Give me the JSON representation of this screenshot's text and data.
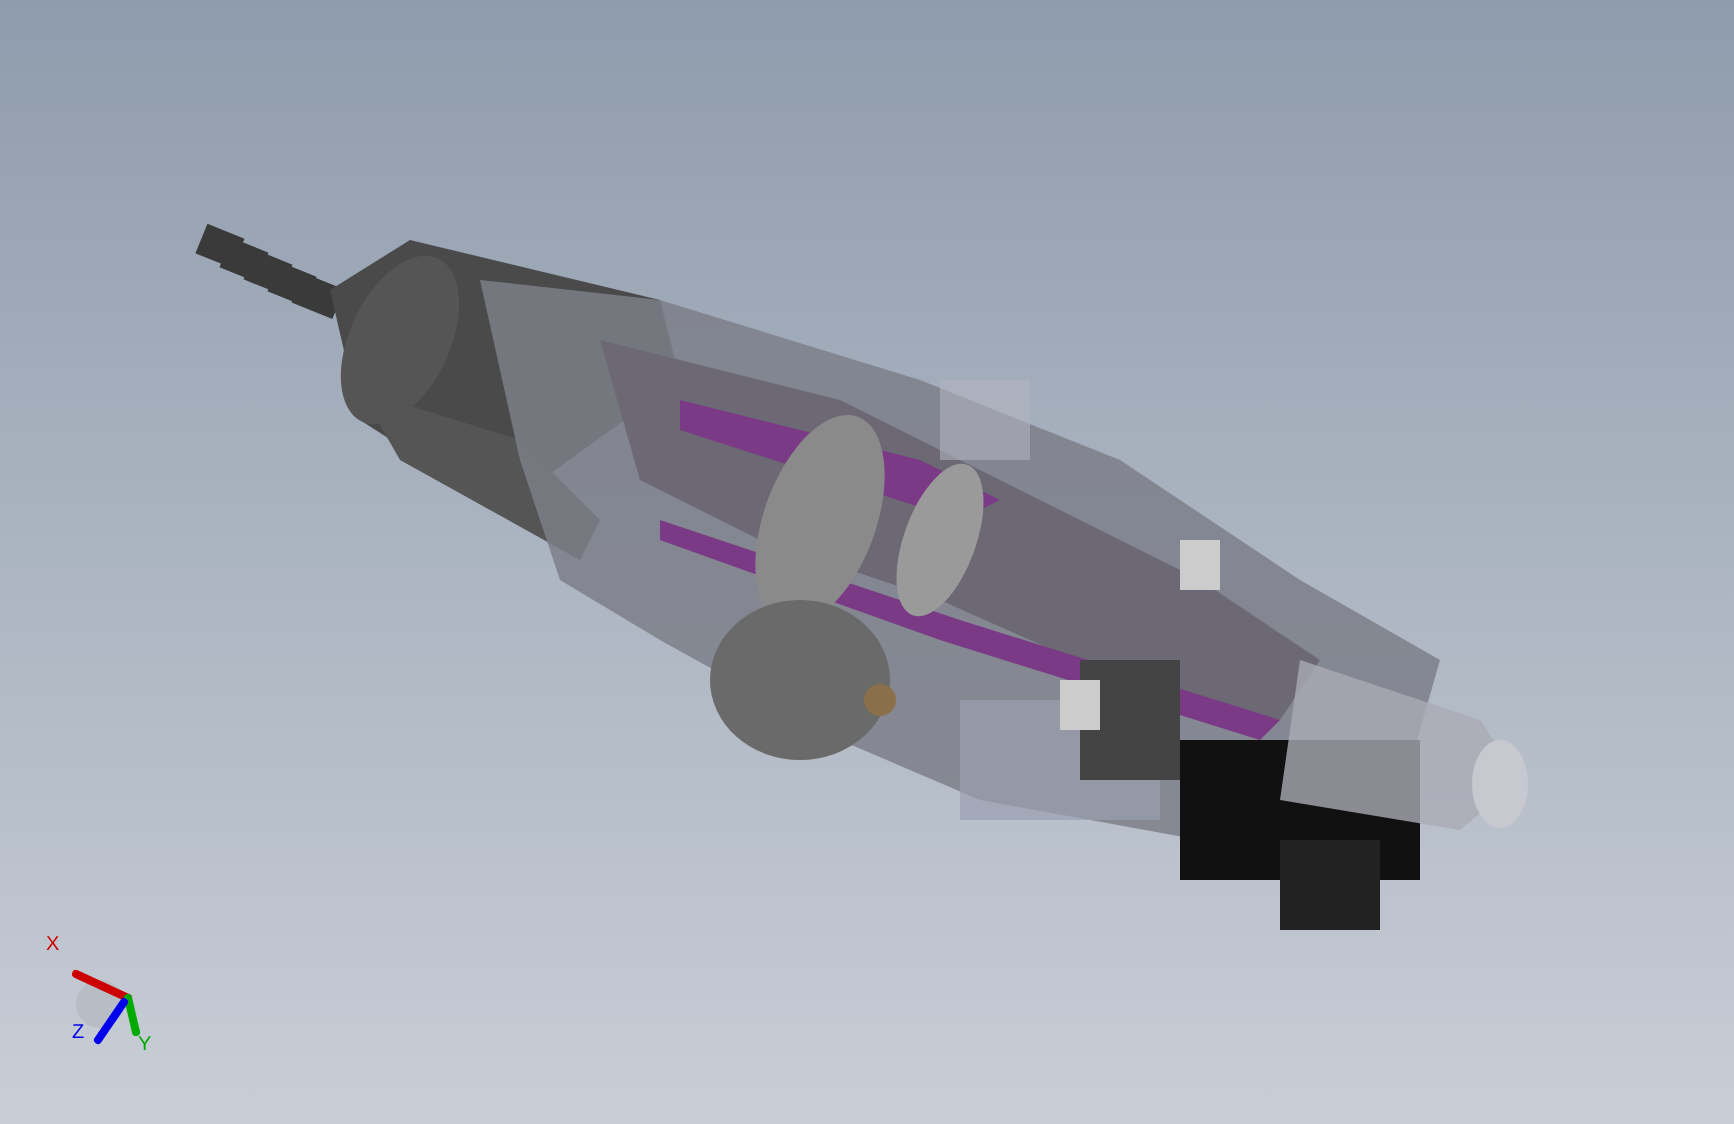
{
  "viewport": {
    "triad": {
      "axes": [
        {
          "label": "X",
          "color": "#cc0000"
        },
        {
          "label": "Y",
          "color": "#00aa00"
        },
        {
          "label": "Z",
          "color": "#0000ee"
        }
      ]
    }
  }
}
